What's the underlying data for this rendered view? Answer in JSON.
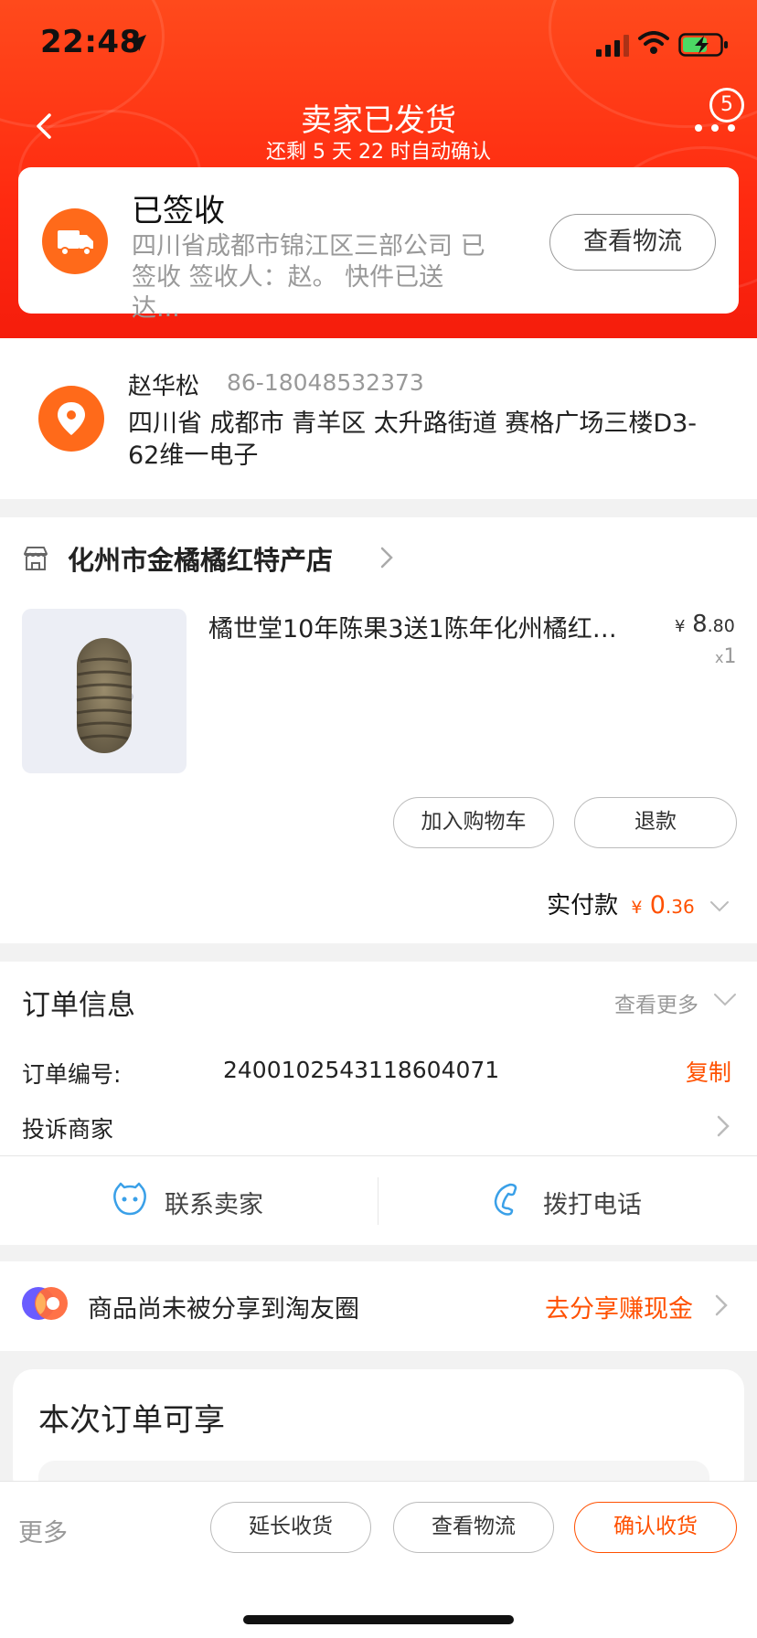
{
  "status_bar": {
    "time": "22:48"
  },
  "nav": {
    "title": "卖家已发货",
    "subtitle": "还剩 5 天 22 时自动确认",
    "badge": "5"
  },
  "logistics": {
    "status": "已签收",
    "detail": "四川省成都市锦江区三部公司 已签收 签收人：赵。 快件已送达...",
    "button": "查看物流"
  },
  "address": {
    "name": "赵华松",
    "phone": "86-18048532373",
    "line": "四川省 成都市 青羊区 太升路街道 赛格广场三楼D3-62维一电子"
  },
  "shop": {
    "name": "化州市金橘橘红特产店",
    "product": {
      "title": "橘世堂10年陈果3送1陈年化州橘红…",
      "price_symbol": "¥",
      "price_int": "8",
      "price_dec": ".80",
      "qty_prefix": "x",
      "qty": "1"
    },
    "add_cart": "加入购物车",
    "refund": "退款",
    "paid_label": "实付款",
    "paid_symbol": "¥",
    "paid_int": "0",
    "paid_dec": ".36"
  },
  "order_info": {
    "title": "订单信息",
    "view_more": "查看更多",
    "order_no_label": "订单编号:",
    "order_no": "2400102543118604071",
    "copy": "复制",
    "complain": "投诉商家",
    "contact_seller": "联系卖家",
    "call": "拨打电话"
  },
  "share": {
    "text": "商品尚未被分享到淘友圈",
    "cta": "去分享赚现金"
  },
  "benefits": {
    "title": "本次订单可享"
  },
  "bottom": {
    "more": "更多",
    "extend": "延长收货",
    "view_logistics": "查看物流",
    "confirm": "确认收货"
  },
  "colors": {
    "accent": "#ff5000",
    "header": "#ff3a14",
    "icon_orange": "#ff6a1a",
    "link_blue": "#3aa0e8"
  }
}
